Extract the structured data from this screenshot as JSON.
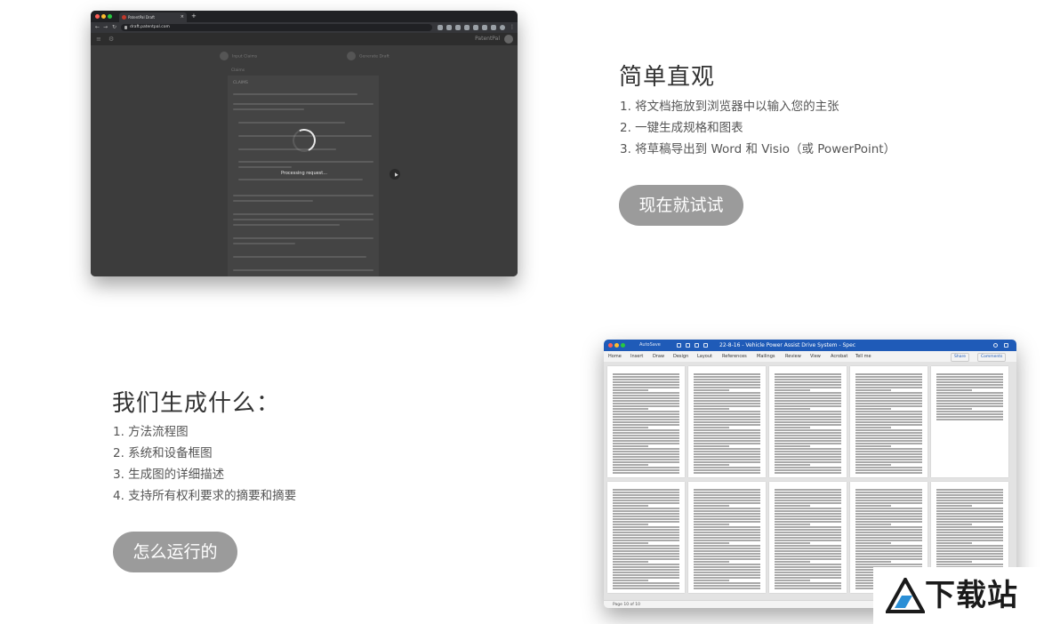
{
  "screenshot1": {
    "tab_title": "PatentPal Draft",
    "tab_close": "×",
    "new_tab": "+",
    "url": "draft.patentpal.com",
    "brand": "PatentPal",
    "steps": [
      "Input Claims",
      "Generate Draft"
    ],
    "claims_label": "Claims",
    "doc_heading": "CLAIMS",
    "processing_text": "Processing request..."
  },
  "section1": {
    "title": "简单直观",
    "items": [
      "1. 将文档拖放到浏览器中以输入您的主张",
      "2. 一键生成规格和图表",
      "3. 将草稿导出到 Word 和 Visio（或 PowerPoint）"
    ],
    "button_label": "现在就试试"
  },
  "section2": {
    "title": "我们生成什么：",
    "items": [
      "1. 方法流程图",
      "2. 系统和设备框图",
      "3. 生成图的详细描述",
      "4. 支持所有权利要求的摘要和摘要"
    ],
    "button_label": "怎么运行的"
  },
  "screenshot2": {
    "autosave": "AutoSave",
    "doc_title": "22-8-16 - Vehicle Power Assist Drive System - Spec",
    "ribbon_tabs": [
      "Home",
      "Insert",
      "Draw",
      "Design",
      "Layout",
      "References",
      "Mailings",
      "Review",
      "View",
      "Acrobat",
      "Tell me"
    ],
    "share_label": "Share",
    "comments_label": "Comments",
    "status": "Page 10 of 10"
  },
  "watermark": {
    "text": "下载站"
  },
  "colors": {
    "button_bg": "#9b9b9b",
    "word_blue": "#1f5bb8",
    "dark_overlay": "#3c3c3c"
  }
}
